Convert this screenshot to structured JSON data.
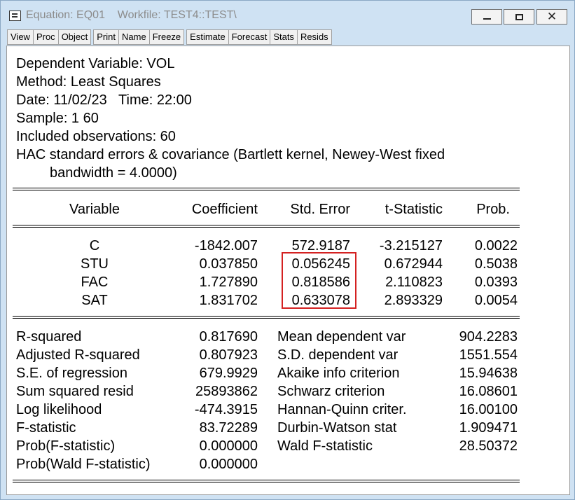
{
  "window": {
    "title": "Equation: EQ01    Workfile: TEST4::TEST\\"
  },
  "toolbar": [
    [
      "View",
      "Proc",
      "Object"
    ],
    [
      "Print",
      "Name",
      "Freeze"
    ],
    [
      "Estimate",
      "Forecast",
      "Stats",
      "Resids"
    ]
  ],
  "header": {
    "dependent": "Dependent Variable: VOL",
    "method": "Method: Least Squares",
    "date": "Date: 11/02/23   Time: 22:00",
    "sample": "Sample: 1 60",
    "included": "Included observations: 60",
    "hac_line1": "HAC standard errors & covariance (Bartlett kernel, Newey-West fixed",
    "hac_line2": "bandwidth = 4.0000)"
  },
  "table": {
    "columns": [
      "Variable",
      "Coefficient",
      "Std. Error",
      "t-Statistic",
      "Prob."
    ],
    "rows": [
      [
        "C",
        "-1842.007",
        "572.9187",
        "-3.215127",
        "0.0022"
      ],
      [
        "STU",
        "0.037850",
        "0.056245",
        "0.672944",
        "0.5038"
      ],
      [
        "FAC",
        "1.727890",
        "0.818586",
        "2.110823",
        "0.0393"
      ],
      [
        "SAT",
        "1.831702",
        "0.633078",
        "2.893329",
        "0.0054"
      ]
    ]
  },
  "stats": {
    "left": [
      [
        "R-squared",
        "0.817690"
      ],
      [
        "Adjusted R-squared",
        "0.807923"
      ],
      [
        "S.E. of regression",
        "679.9929"
      ],
      [
        "Sum squared resid",
        "25893862"
      ],
      [
        "Log likelihood",
        "-474.3915"
      ],
      [
        "F-statistic",
        "83.72289"
      ],
      [
        "Prob(F-statistic)",
        "0.000000"
      ],
      [
        "Prob(Wald F-statistic)",
        "0.000000"
      ]
    ],
    "right": [
      [
        "Mean dependent var",
        "904.2283"
      ],
      [
        "S.D. dependent var",
        "1551.554"
      ],
      [
        "Akaike info criterion",
        "15.94638"
      ],
      [
        "Schwarz criterion",
        "16.08601"
      ],
      [
        "Hannan-Quinn criter.",
        "16.00100"
      ],
      [
        "Durbin-Watson stat",
        "1.909471"
      ],
      [
        "Wald F-statistic",
        "28.50372"
      ]
    ]
  },
  "colors": {
    "titlebar": "#cfe2f3",
    "highlight": "#d42121"
  }
}
